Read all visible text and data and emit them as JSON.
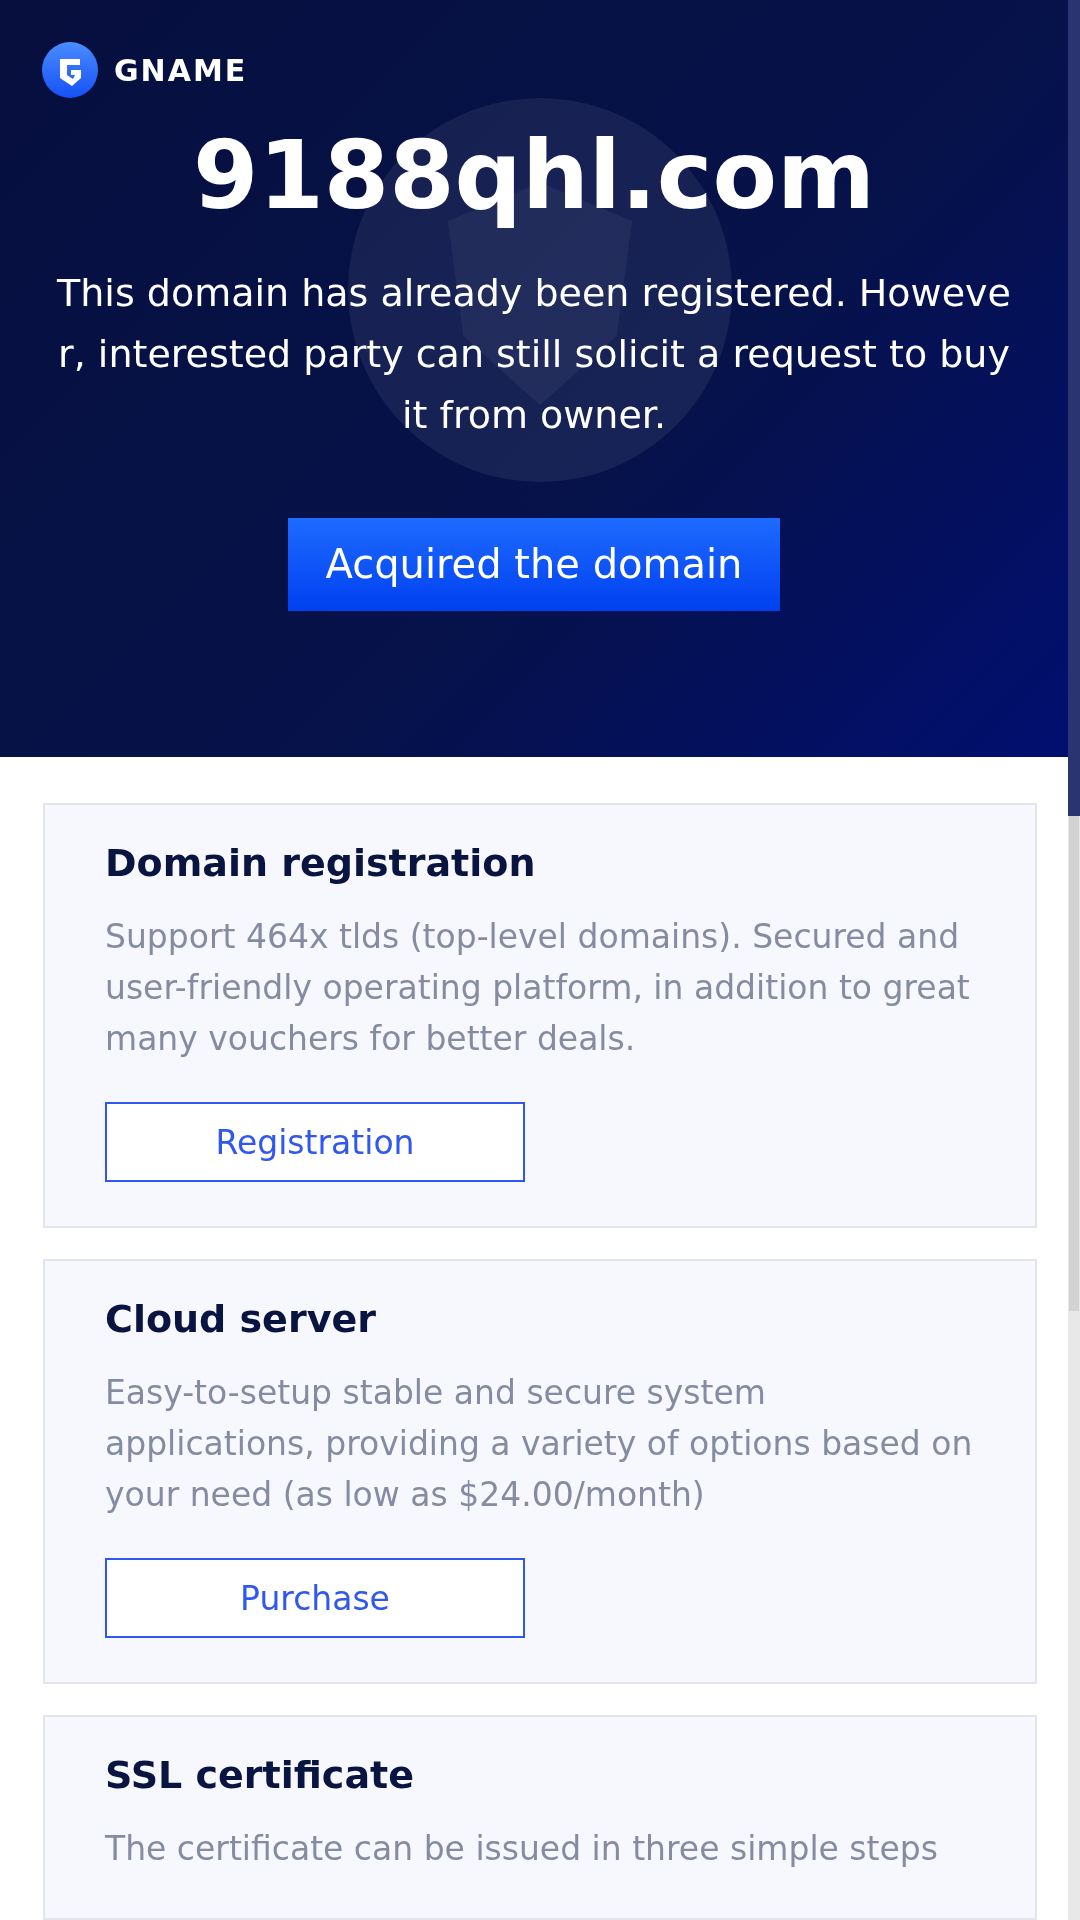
{
  "header": {
    "brand": "GNAME",
    "domain": "9188qhl.com",
    "message": "This domain has already been registered. However, interested party can still solicit a request to buy it from owner.",
    "button": "Acquired the domain"
  },
  "services": [
    {
      "title": "Domain registration",
      "description": "Support 464x tlds (top-level domains). Secured and user-friendly operating platform, in addition to great many vouchers for better deals.",
      "button": "Registration"
    },
    {
      "title": "Cloud server",
      "description": "Easy-to-setup stable and secure system applications, providing a variety of options based on your need (as low as $24.00/month)",
      "button": "Purchase"
    },
    {
      "title": "SSL certificate",
      "description": "The certificate can be issued in three simple steps"
    }
  ]
}
